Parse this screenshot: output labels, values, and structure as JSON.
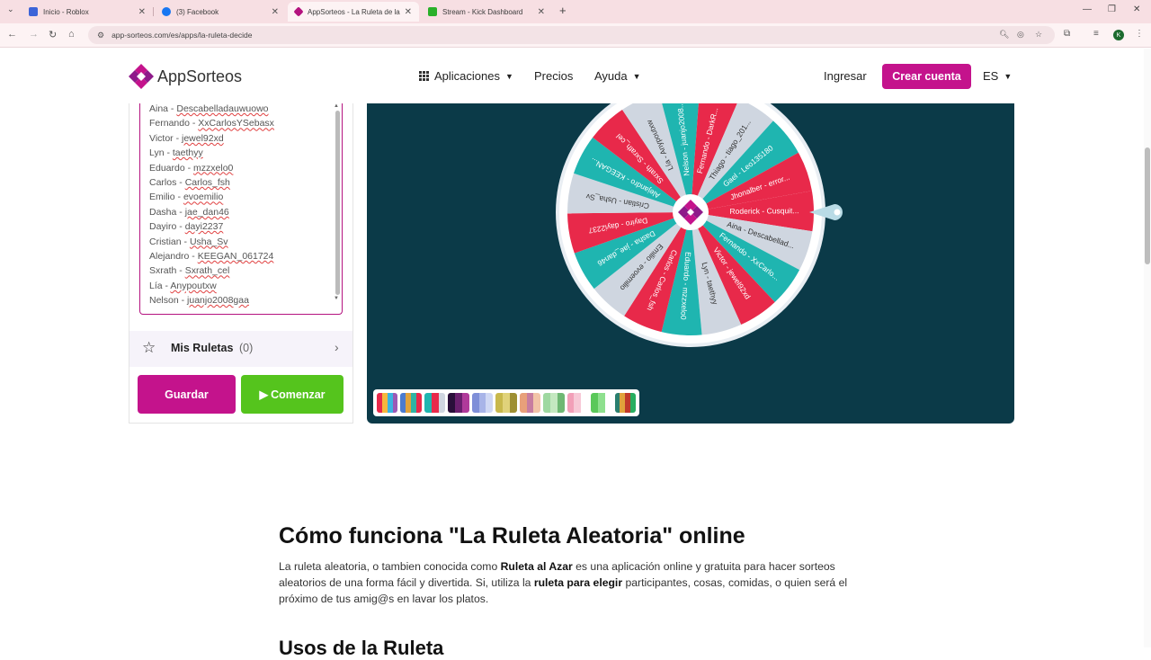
{
  "browser": {
    "tabs": [
      {
        "title": "Inicio - Roblox",
        "favicon_color": "#3c64d8",
        "active": false
      },
      {
        "title": "(3) Facebook",
        "favicon_color": "#1877f2",
        "active": false
      },
      {
        "title": "AppSorteos - La Ruleta de la Suerte",
        "favicon_color": "#b4137f",
        "active": true
      },
      {
        "title": "Stream - Kick Dashboard",
        "favicon_color": "#2ab02a",
        "active": false
      }
    ],
    "url": "app-sorteos.com/es/apps/la-ruleta-decide",
    "profile_initial": "K"
  },
  "header": {
    "logo_text": "AppSorteos",
    "menu": {
      "apps": "Aplicaciones",
      "prices": "Precios",
      "help": "Ayuda",
      "login": "Ingresar",
      "register": "Crear cuenta",
      "lang": "ES"
    }
  },
  "entries": [
    {
      "name": "Aina",
      "tag": "Descabelladauwuowo"
    },
    {
      "name": "Fernando",
      "tag": "XxCarlosYSebasx"
    },
    {
      "name": "Victor",
      "tag": "jewel92xd"
    },
    {
      "name": "Lyn",
      "tag": "taethyy"
    },
    {
      "name": "Eduardo",
      "tag": "mzzxelo0"
    },
    {
      "name": "Carlos",
      "tag": "Carlos_fsh"
    },
    {
      "name": "Emilio",
      "tag": "evoemilio"
    },
    {
      "name": "Dasha",
      "tag": "jae_dan46"
    },
    {
      "name": "Dayiro ",
      "tag": "dayi2237"
    },
    {
      "name": "Cristian",
      "tag": "Usha_Sv"
    },
    {
      "name": "Alejandro",
      "tag": "KEEGAN_061724"
    },
    {
      "name": "Sxrath",
      "tag": "Sxrath_cel"
    },
    {
      "name": "Lía",
      "tag": "Anypoutxw"
    },
    {
      "name": "Nelson",
      "tag": "juanjo2008gaa"
    }
  ],
  "my_roulettes": {
    "label": "Mis Ruletas",
    "count": "(0)"
  },
  "buttons": {
    "save": "Guardar",
    "start": "Comenzar"
  },
  "wheel": {
    "segments": [
      "Roderick - Cusquit...",
      "Aina - Descabellad...",
      "Fernando - XxCarlo...",
      "Victor - jewel92xd",
      "Lyn - taethyy",
      "Eduardo - mzzxelo0",
      "Carlos - Carlos_fsh",
      "Emilio - evoemilio",
      "Dasha - jae_dan46",
      "Dayiro - dayi2237",
      "Cristian - Usha_Sv",
      "Alejandro - KEEGAN...",
      "Sxrath - Sxrath_cel",
      "Lía - Anypoutxw",
      "Nelson - juanjo2008...",
      "Fernando - DarkR...",
      "Thiago - tiago_201...",
      "Gael - Leo135180",
      "Jhonalber - error..."
    ],
    "colors": [
      "#e8294a",
      "#cfd6e0",
      "#1fb5b0"
    ]
  },
  "content": {
    "title": "Cómo funciona \"La Ruleta Aleatoria\" online",
    "p1": "La ruleta aleatoria, o tambien conocida como ",
    "p1_b1": "Ruleta al Azar",
    "p1_2": " es una aplicación online y gratuita para hacer sorteos aleatorios de una forma fácil y divertida. Si, utiliza la ",
    "p1_b2": "ruleta para elegir",
    "p1_3": " participantes, cosas, comidas, o quien será el próximo de tus amig@s en lavar los platos.",
    "subtitle": "Usos de la Ruleta"
  }
}
